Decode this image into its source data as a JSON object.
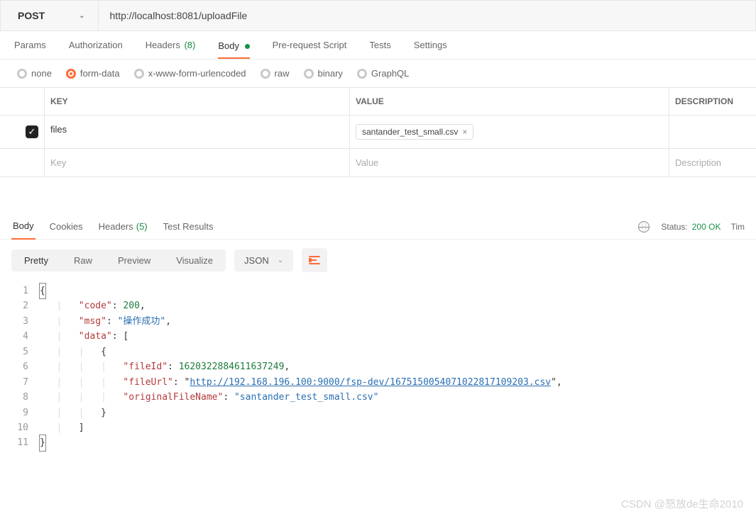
{
  "request": {
    "method": "POST",
    "url": "http://localhost:8081/uploadFile"
  },
  "reqTabs": {
    "params": "Params",
    "auth": "Authorization",
    "headers": "Headers",
    "headersCount": "(8)",
    "body": "Body",
    "prereq": "Pre-request Script",
    "tests": "Tests",
    "settings": "Settings"
  },
  "bodyTypes": {
    "none": "none",
    "formData": "form-data",
    "urlenc": "x-www-form-urlencoded",
    "raw": "raw",
    "binary": "binary",
    "graphql": "GraphQL"
  },
  "table": {
    "head": {
      "key": "KEY",
      "value": "VALUE",
      "desc": "DESCRIPTION"
    },
    "row": {
      "key": "files",
      "fileChip": "santander_test_small.csv"
    },
    "placeholder": {
      "key": "Key",
      "value": "Value",
      "desc": "Description"
    }
  },
  "respTabs": {
    "body": "Body",
    "cookies": "Cookies",
    "headers": "Headers",
    "headersCount": "(5)",
    "testResults": "Test Results"
  },
  "respStatus": {
    "label": "Status:",
    "value": "200 OK",
    "time": "Tim"
  },
  "viewModes": {
    "pretty": "Pretty",
    "raw": "Raw",
    "preview": "Preview",
    "visualize": "Visualize",
    "lang": "JSON"
  },
  "code": {
    "l1": "{",
    "l2_k": "\"code\"",
    "l2_v": "200",
    "l3_k": "\"msg\"",
    "l3_v": "\"操作成功\"",
    "l4_k": "\"data\"",
    "l6_k": "\"fileId\"",
    "l6_v": "1620322884611637249",
    "l7_k": "\"fileUrl\"",
    "l7_v": "http://192.168.196.100:9000/fsp-dev/1675150054071022817109203.csv",
    "l8_k": "\"originalFileName\"",
    "l8_v": "\"santander_test_small.csv\""
  },
  "lineNums": {
    "n1": "1",
    "n2": "2",
    "n3": "3",
    "n4": "4",
    "n5": "5",
    "n6": "6",
    "n7": "7",
    "n8": "8",
    "n9": "9",
    "n10": "10",
    "n11": "11"
  },
  "watermark": "CSDN @怒放de生命2010"
}
